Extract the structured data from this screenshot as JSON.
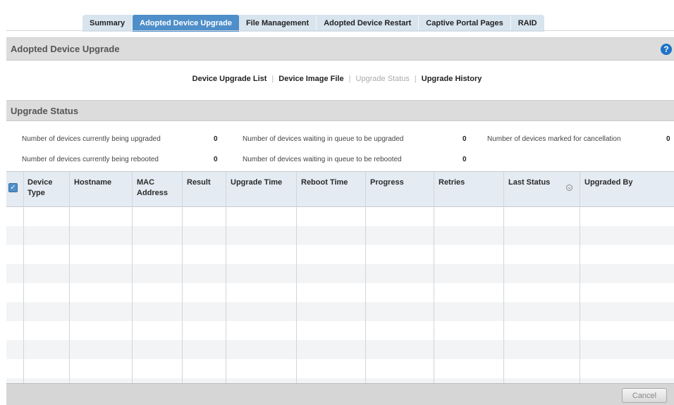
{
  "tabs": [
    {
      "label": "Summary"
    },
    {
      "label": "Adopted Device Upgrade"
    },
    {
      "label": "File Management"
    },
    {
      "label": "Adopted Device Restart"
    },
    {
      "label": "Captive Portal Pages"
    },
    {
      "label": "RAID"
    }
  ],
  "active_tab": "Adopted Device Upgrade",
  "page": {
    "title": "Adopted Device Upgrade",
    "help_label": "?"
  },
  "subnav": {
    "items": [
      {
        "label": "Device Upgrade List"
      },
      {
        "label": "Device Image File"
      },
      {
        "label": "Upgrade Status"
      },
      {
        "label": "Upgrade History"
      }
    ],
    "current": "Upgrade Status"
  },
  "section": {
    "title": "Upgrade Status"
  },
  "stats": {
    "currently_upgraded": {
      "label": "Number of devices currently being upgraded",
      "value": "0"
    },
    "queue_upgraded": {
      "label": "Number of devices waiting in queue to be upgraded",
      "value": "0"
    },
    "marked_cancellation": {
      "label": "Number of devices marked for cancellation",
      "value": "0"
    },
    "currently_rebooted": {
      "label": "Number of devices currently being rebooted",
      "value": "0"
    },
    "queue_rebooted": {
      "label": "Number of devices waiting in queue to be rebooted",
      "value": "0"
    }
  },
  "table": {
    "select_all_checked": true,
    "columns": [
      {
        "line1": "Device",
        "line2": "Type"
      },
      {
        "line1": "Hostname",
        "line2": ""
      },
      {
        "line1": "MAC",
        "line2": "Address"
      },
      {
        "line1": "Result",
        "line2": ""
      },
      {
        "line1": "Upgrade Time",
        "line2": ""
      },
      {
        "line1": "Reboot Time",
        "line2": ""
      },
      {
        "line1": "Progress",
        "line2": ""
      },
      {
        "line1": "Retries",
        "line2": ""
      },
      {
        "line1": "Last Status",
        "line2": ""
      },
      {
        "line1": "Upgraded By",
        "line2": ""
      }
    ],
    "rows": []
  },
  "footer": {
    "cancel_label": "Cancel"
  },
  "colors": {
    "active_tab": "#4e8ec9",
    "tab_bar": "#d8e4ee",
    "section_bar": "#dcdcdc",
    "table_header": "#e4ebf2",
    "help_icon": "#1f72c8"
  }
}
